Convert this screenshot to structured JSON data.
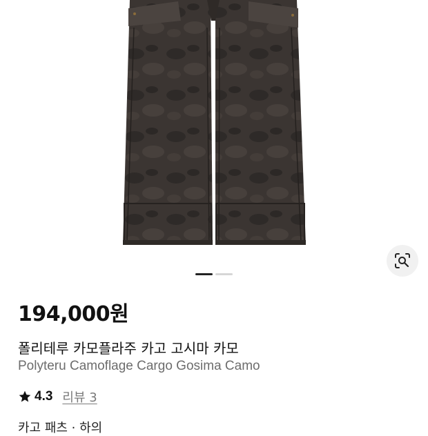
{
  "product": {
    "price": "194,000원",
    "title_ko": "폴리테루 카모플라주 카고 고시마 카모",
    "title_en": "Polyteru Camoflage Cargo Gosima Camo",
    "rating": "4.3",
    "review_label": "리뷰 3",
    "next_section_text": "카고 패츠 · 하의"
  },
  "gallery": {
    "current_index": 1,
    "total_images": 2
  },
  "icons": {
    "lens": "visual-search-icon",
    "rating": "star-icon"
  },
  "colors": {
    "pants": "#3a3431",
    "pager_active": "#222222",
    "pager_inactive": "#d6d6d6"
  }
}
